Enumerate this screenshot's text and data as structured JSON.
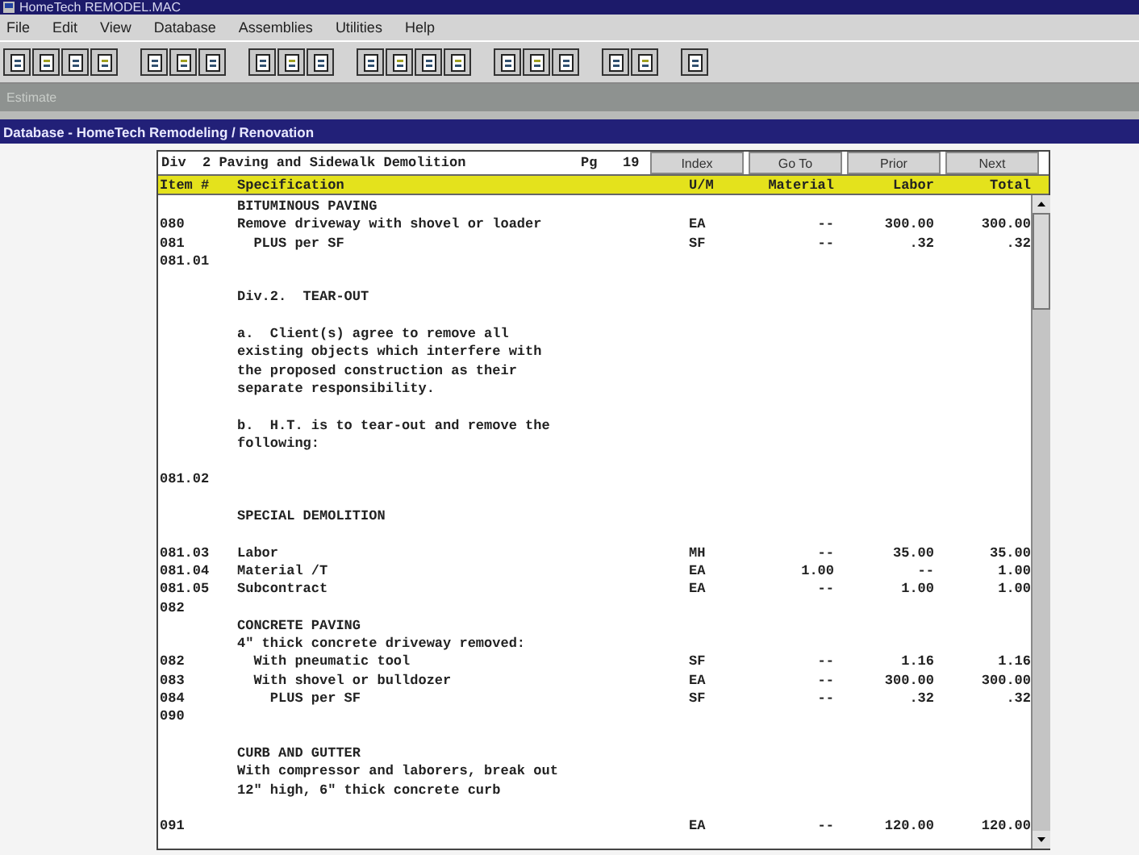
{
  "window": {
    "title": "HomeTech REMODEL.MAC"
  },
  "menu": [
    "File",
    "Edit",
    "View",
    "Database",
    "Assemblies",
    "Utilities",
    "Help"
  ],
  "estimate_bar": {
    "label": "Estimate"
  },
  "database_bar": {
    "title": "Database - HomeTech Remodeling / Renovation"
  },
  "document": {
    "division": "Div  2 Paving and Sidewalk Demolition",
    "page_label": "Pg",
    "page": "19",
    "buttons": [
      "Index",
      "Go To",
      "Prior",
      "Next"
    ],
    "columns": [
      "Item #",
      "Specification",
      "U/M",
      "Material",
      "Labor",
      "Total"
    ],
    "rows": [
      {
        "spec": "BITUMINOUS PAVING"
      },
      {
        "item": "080",
        "spec": "Remove driveway with shovel or loader",
        "um": "EA",
        "material": "--",
        "labor": "300.00",
        "total": "300.00"
      },
      {
        "item": "081",
        "spec": "  PLUS per SF",
        "um": "SF",
        "material": "--",
        "labor": ".32",
        "total": ".32"
      },
      {
        "item": "081.01"
      },
      {
        "space_before": true,
        "spec": "Div.2.  TEAR-OUT"
      },
      {
        "space_before": true,
        "spec": "a.  Client(s) agree to remove all"
      },
      {
        "spec": "existing objects which interfere with"
      },
      {
        "spec": "the proposed construction as their"
      },
      {
        "spec": "separate responsibility."
      },
      {
        "space_before": true,
        "spec": "b.  H.T. is to tear-out and remove the"
      },
      {
        "spec": "following:"
      },
      {
        "space_before": true,
        "item": "081.02"
      },
      {
        "space_before": true,
        "spec": "SPECIAL DEMOLITION"
      },
      {
        "space_before": true,
        "item": "081.03",
        "spec": "Labor",
        "um": "MH",
        "material": "--",
        "labor": "35.00",
        "total": "35.00"
      },
      {
        "item": "081.04",
        "spec": "Material /T",
        "um": "EA",
        "material": "1.00",
        "labor": "--",
        "total": "1.00"
      },
      {
        "item": "081.05",
        "spec": "Subcontract",
        "um": "EA",
        "material": "--",
        "labor": "1.00",
        "total": "1.00"
      },
      {
        "item": "082"
      },
      {
        "spec": "CONCRETE PAVING"
      },
      {
        "spec": "4\" thick concrete driveway removed:"
      },
      {
        "item": "082",
        "spec": "  With pneumatic tool",
        "um": "SF",
        "material": "--",
        "labor": "1.16",
        "total": "1.16"
      },
      {
        "item": "083",
        "spec": "  With shovel or bulldozer",
        "um": "EA",
        "material": "--",
        "labor": "300.00",
        "total": "300.00"
      },
      {
        "item": "084",
        "spec": "    PLUS per SF",
        "um": "SF",
        "material": "--",
        "labor": ".32",
        "total": ".32"
      },
      {
        "item": "090"
      },
      {
        "space_before": true,
        "spec": "CURB AND GUTTER"
      },
      {
        "spec": "With compressor and laborers, break out"
      },
      {
        "spec": "12\" high, 6\" thick concrete curb"
      },
      {
        "space_before": true,
        "item": "091",
        "um": "EA",
        "material": "--",
        "labor": "120.00",
        "total": "120.00"
      }
    ]
  }
}
